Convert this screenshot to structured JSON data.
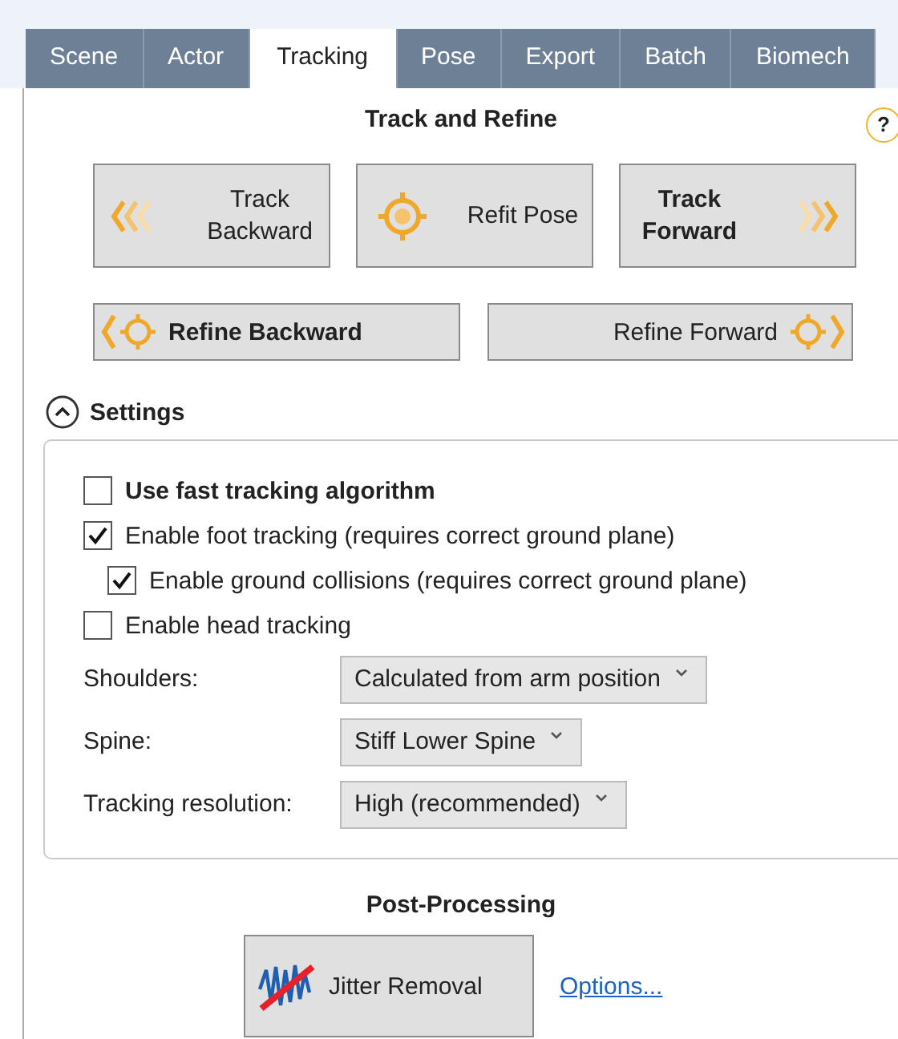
{
  "tabs": [
    {
      "label": "Scene",
      "selected": false
    },
    {
      "label": "Actor",
      "selected": false
    },
    {
      "label": "Tracking",
      "selected": true
    },
    {
      "label": "Pose",
      "selected": false
    },
    {
      "label": "Export",
      "selected": false
    },
    {
      "label": "Batch",
      "selected": false
    },
    {
      "label": "Biomech",
      "selected": false
    }
  ],
  "track_section": {
    "title": "Track and Refine",
    "help": "?",
    "buttons": [
      {
        "kind": "back",
        "label": "Track Backward",
        "bold": false
      },
      {
        "kind": "refit",
        "label": "Refit Pose",
        "bold": false
      },
      {
        "kind": "forward",
        "label": "Track Forward",
        "bold": true
      }
    ],
    "refine_buttons": [
      {
        "kind": "back",
        "label": "Refine Backward",
        "bold": true
      },
      {
        "kind": "forward",
        "label": "Refine Forward",
        "bold": false
      }
    ]
  },
  "settings": {
    "title": "Settings",
    "expanded": true,
    "checkboxes": [
      {
        "label": "Use fast tracking algorithm",
        "checked": false,
        "bold": true
      },
      {
        "label": "Enable foot tracking (requires correct ground plane)",
        "checked": true,
        "bold": false,
        "children": [
          {
            "label": "Enable ground collisions (requires correct ground plane)",
            "checked": true,
            "bold": false
          }
        ]
      },
      {
        "label": "Enable head tracking",
        "checked": false,
        "bold": false
      }
    ],
    "dropdowns": [
      {
        "label": "Shoulders:",
        "value": "Calculated from arm position"
      },
      {
        "label": "Spine:",
        "value": "Stiff Lower Spine"
      },
      {
        "label": "Tracking resolution:",
        "value": "High (recommended)"
      }
    ]
  },
  "post_processing": {
    "title": "Post-Processing",
    "button": "Jitter Removal",
    "link": "Options..."
  }
}
